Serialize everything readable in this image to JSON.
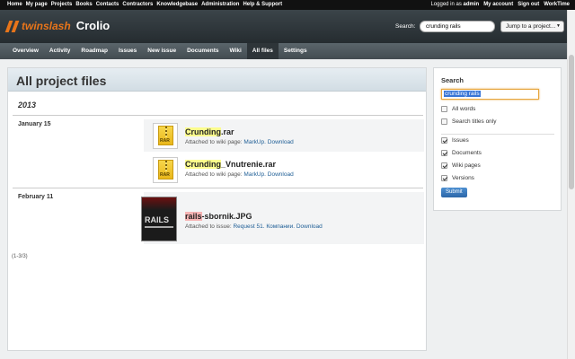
{
  "topbar": {
    "menu": [
      "Home",
      "My page",
      "Projects",
      "Books",
      "Contacts",
      "Contractors",
      "Knowledgebase",
      "Administration",
      "Help & Support"
    ],
    "logged_in_prefix": "Logged in as",
    "logged_in_user": "admin",
    "account": [
      "My account",
      "Sign out",
      "WorkTime"
    ]
  },
  "header": {
    "brand": "twinslash",
    "project": "Crolio",
    "search_label": "Search:",
    "search_value": "crunding rails",
    "jump_label": "Jump to a project...",
    "accent_color": "#e8751a"
  },
  "mainmenu": [
    "Overview",
    "Activity",
    "Roadmap",
    "Issues",
    "New issue",
    "Documents",
    "Wiki",
    "All files",
    "Settings"
  ],
  "main": {
    "title": "All project files",
    "year": "2013",
    "groups": [
      {
        "date": "January 15",
        "files": [
          {
            "highlight": "Crunding",
            "rest": ".rar",
            "attached_prefix": "Attached to wiki page:",
            "link1": "MarkUp.",
            "link2": "Download",
            "icon": "rar-archive-icon"
          },
          {
            "highlight": "Crunding",
            "rest": "_Vnutrenie.rar",
            "attached_prefix": "Attached to wiki page:",
            "link1": "MarkUp.",
            "link2": "Download",
            "icon": "rar-archive-icon"
          }
        ]
      },
      {
        "date": "February 11",
        "files": [
          {
            "highlight": "rails",
            "rest": "-sbornik.JPG",
            "attached_prefix": "Attached to issue:",
            "link1": "Request 51. Компании.",
            "link2": "Download",
            "icon": "rails-book-thumbnail",
            "thumb_text": "RAILS"
          }
        ]
      }
    ],
    "pagination": "(1-3/3)"
  },
  "sidebar": {
    "title": "Search",
    "search_value": "crunding rails",
    "options": [
      {
        "label": "All words",
        "checked": false
      },
      {
        "label": "Search titles only",
        "checked": false
      },
      {
        "label": "Issues",
        "checked": true
      },
      {
        "label": "Documents",
        "checked": true
      },
      {
        "label": "Wiki pages",
        "checked": true
      },
      {
        "label": "Versions",
        "checked": true
      }
    ],
    "submit_label": "Submit"
  }
}
